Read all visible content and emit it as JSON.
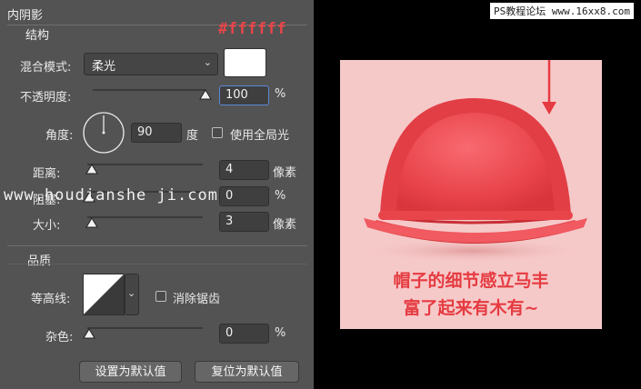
{
  "section_title": "内阴影",
  "structure": {
    "title": "结构",
    "hex_annotation": "#ffffff",
    "blend_mode_label": "混合模式:",
    "blend_mode_value": "柔光",
    "opacity_label": "不透明度:",
    "opacity_value": "100",
    "opacity_unit": "%",
    "opacity_level": 1.0,
    "angle_label": "角度:",
    "angle_value": "90",
    "angle_unit": "度",
    "global_light_label": "使用全局光",
    "distance_label": "距离:",
    "distance_value": "4",
    "distance_unit": "像素",
    "choke_label": "阻塞:",
    "choke_value": "0",
    "choke_unit": "%",
    "size_label": "大小:",
    "size_value": "3",
    "size_unit": "像素"
  },
  "quality": {
    "title": "品质",
    "contour_label": "等高线:",
    "antialias_label": "消除锯齿",
    "noise_label": "杂色:",
    "noise_value": "0",
    "noise_unit": "%"
  },
  "buttons": {
    "set_default": "设置为默认值",
    "reset_default": "复位为默认值"
  },
  "watermark": "www.houdianshe ji.com",
  "site_badge": "PS教程论坛 www.16xx8.com",
  "caption": {
    "line1": "帽子的细节感立马丰",
    "line2": "富了起来有木有~"
  },
  "colors": {
    "panel_bg": "#535353",
    "accent_red": "#e8454a",
    "swatch": "#ffffff",
    "preview_bg": "#f6c9c9",
    "hat_red": "#e83c44"
  }
}
